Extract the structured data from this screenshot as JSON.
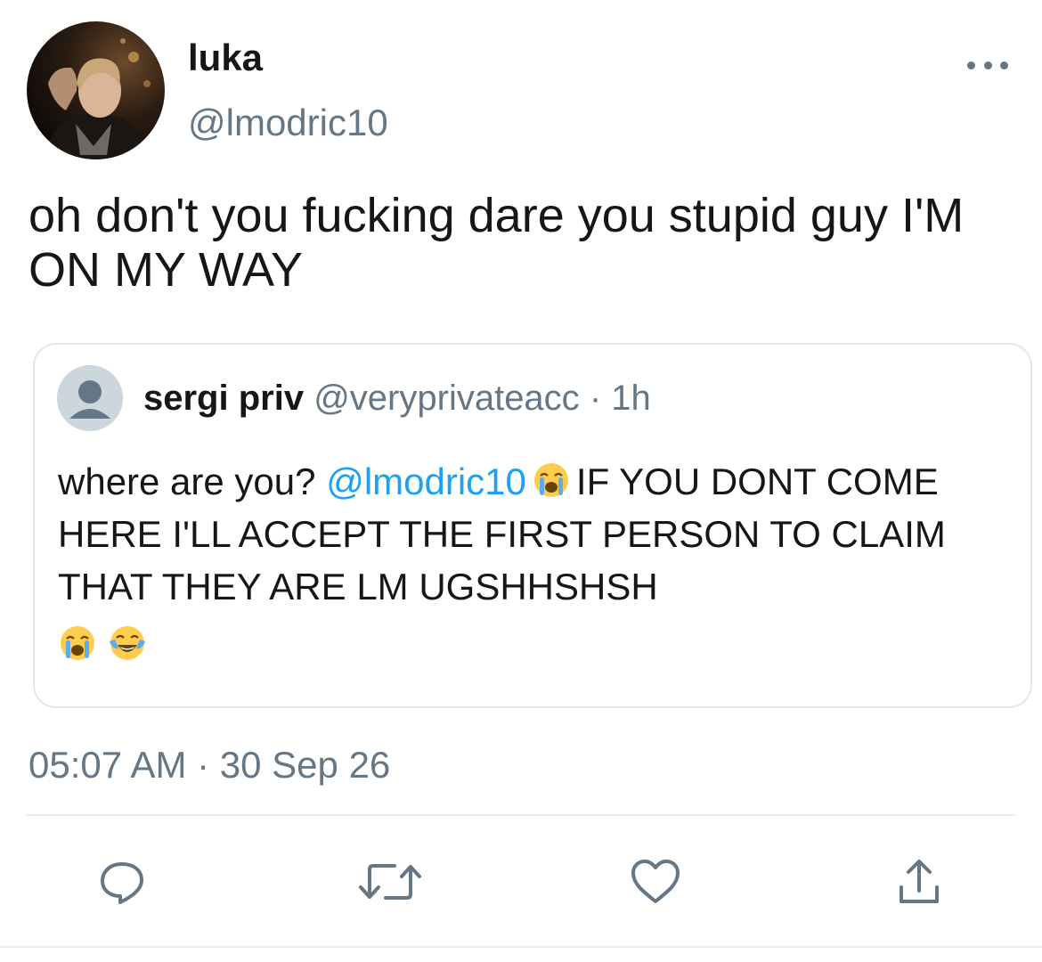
{
  "tweet": {
    "display_name": "luka",
    "handle": "@lmodric10",
    "text": "oh don't you fucking dare you stupid guy I'M ON MY WAY",
    "timestamp": "05:07 AM · 30 Sep 26"
  },
  "quoted": {
    "display_name": "sergi priv",
    "handle": "@veryprivateacc",
    "time_ago": "1h",
    "text_before_mention": "where are you?",
    "mention": "@lmodric10",
    "text_after_mention": "IF YOU DONT COME HERE I'LL ACCEPT THE FIRST PERSON TO CLAIM THAT THEY ARE LM UGSHHSHSH",
    "emojis": [
      "loudly-crying-face",
      "face-with-tears-of-joy"
    ]
  },
  "actions": [
    "reply-icon",
    "retweet-icon",
    "like-icon",
    "share-icon"
  ],
  "colors": {
    "text": "#14171a",
    "secondary": "#657786",
    "mention": "#1da1f2",
    "border": "#e1e8ed"
  }
}
